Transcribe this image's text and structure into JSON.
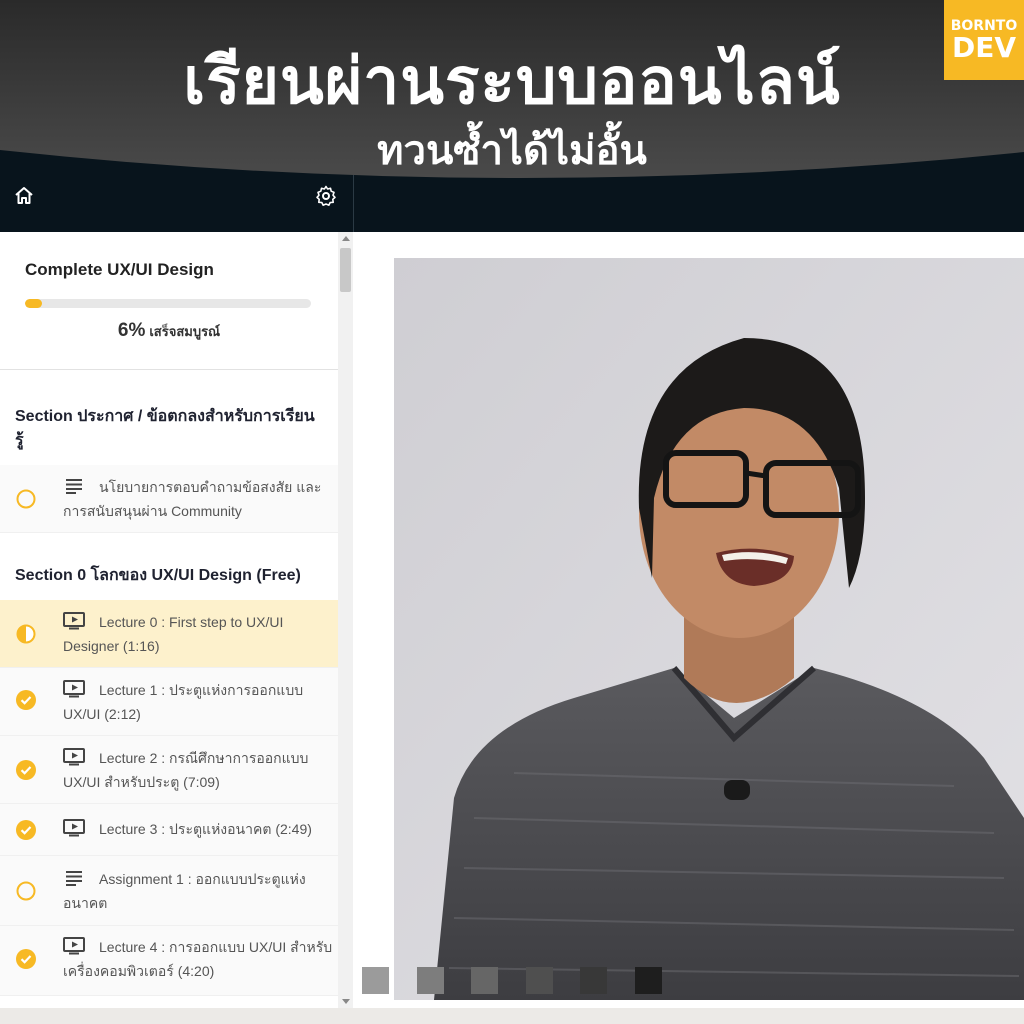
{
  "banner": {
    "title": "เรียนผ่านระบบออนไลน์",
    "subtitle": "ทวนซ้ำได้ไม่อั้น",
    "logo_line1": "BORNTO",
    "logo_line2": "DEV"
  },
  "nav": {
    "home_icon": "home-icon",
    "settings_icon": "gear-icon"
  },
  "course": {
    "title": "Complete UX/UI Design",
    "progress_fraction": 0.06,
    "progress_percent": "6%",
    "progress_label": "เสร็จสมบูรณ์"
  },
  "sections": [
    {
      "title": "Section ประกาศ / ข้อตกลงสำหรับการเรียนรู้",
      "items": [
        {
          "type": "text",
          "status": "incomplete",
          "title": "นโยบายการตอบคำถามข้อสงสัย และการสนับสนุนผ่าน Community"
        }
      ]
    },
    {
      "title": "Section 0 โลกของ UX/UI Design (Free)",
      "items": [
        {
          "type": "video",
          "status": "in-progress",
          "title": "Lecture 0 : First step to UX/UI Designer (1:16)"
        },
        {
          "type": "video",
          "status": "complete",
          "title": "Lecture 1 : ประตูแห่งการออกแบบ UX/UI (2:12)"
        },
        {
          "type": "video",
          "status": "complete",
          "title": "Lecture 2 : กรณีศึกษาการออกแบบ UX/UI สำหรับประตู (7:09)"
        },
        {
          "type": "video",
          "status": "complete",
          "title": "Lecture 3 : ประตูแห่งอนาคต (2:49)"
        },
        {
          "type": "text",
          "status": "incomplete",
          "title": "Assignment 1 : ออกแบบประตูแห่งอนาคต"
        },
        {
          "type": "video",
          "status": "complete",
          "title": "Lecture 4 : การออกแบบ UX/UI สำหรับเครื่องคอมพิวเตอร์ (4:20)"
        }
      ]
    }
  ],
  "colors": {
    "accent": "#f7b924",
    "topbar": "#08141c",
    "active_row": "#fdf1cc",
    "swatches": [
      "#9b9b9b",
      "#7d7d7d",
      "#666666",
      "#4f4f4f",
      "#383838",
      "#1e1e1e"
    ]
  }
}
